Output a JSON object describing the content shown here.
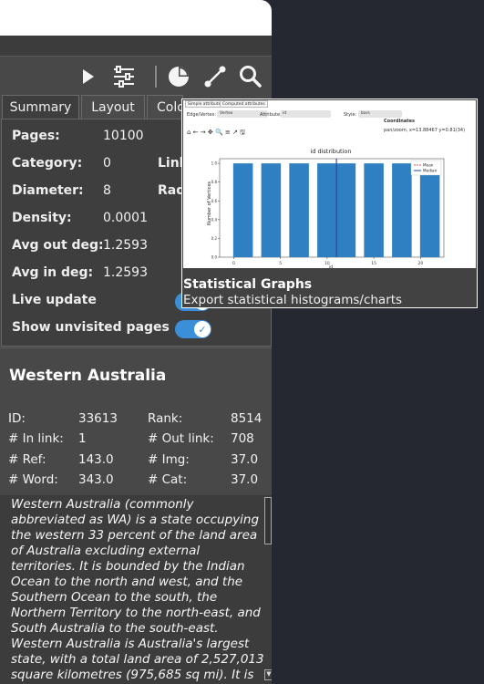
{
  "toolbar": {
    "icons": [
      "play-icon",
      "sliders-icon",
      "pie-chart-icon",
      "graph-edge-icon",
      "search-icon"
    ]
  },
  "tabs": [
    {
      "label": "Summary",
      "active": true
    },
    {
      "label": "Layout",
      "active": false
    },
    {
      "label": "Colo",
      "active": false
    }
  ],
  "summary": {
    "pages_label": "Pages:",
    "pages_value": "10100",
    "category_label": "Category:",
    "category_value": "0",
    "link_label": "Link",
    "diameter_label": "Diameter:",
    "diameter_value": "8",
    "rad_label": "Rad",
    "density_label": "Density:",
    "density_value": "0.0001",
    "avg_out_label": "Avg out deg:",
    "avg_out_value": "1.2593",
    "avg_in_label": "Avg in deg:",
    "avg_in_value": "1.2593",
    "live_update_label": "Live update",
    "live_update_on": true,
    "show_unvisited_label": "Show unvisited pages",
    "show_unvisited_on": true,
    "toggle_check": "✓"
  },
  "page": {
    "title": "Western Australia",
    "id_label": "ID:",
    "id_value": "33613",
    "rank_label": "Rank:",
    "rank_value": "8514",
    "inlink_label": "# In link:",
    "inlink_value": "1",
    "outlink_label": "# Out link:",
    "outlink_value": "708",
    "ref_label": "# Ref:",
    "ref_value": "143.0",
    "img_label": "# Img:",
    "img_value": "37.0",
    "word_label": "# Word:",
    "word_value": "343.0",
    "cat_label": "# Cat:",
    "cat_value": "37.0",
    "description": "Western Australia (commonly abbreviated as WA) is a state occupying the western 33 percent of the land area of Australia excluding external territories. It is bounded by the Indian Ocean to the north and west, and the Southern Ocean to the south, the Northern Territory to the north-east, and South Australia to the south-east. Western Australia is Australia's largest state, with a total land area of 2,527,013 square kilometres (975,685 sq mi). It is the second-largest"
  },
  "tooltip": {
    "title": "Statistical Graphs",
    "subtitle": "Export statistical histograms/charts",
    "preview": {
      "tab1": "Simple attributes",
      "tab2": "Computed attributes",
      "field1_label": "Edge/Vertex:",
      "field1_value": "Vertex",
      "field2_label": "Attribute:",
      "field2_value": "id",
      "field3_label": "Style:",
      "field3_value": "bars",
      "coords_title": "Coordinates",
      "coords_text": "pan/zoom, x=13.88467     y=0.81(34)",
      "chart_title": "id distribution",
      "ylabel": "Number of Vertices",
      "legend_mean": "Mean",
      "legend_median": "Median"
    }
  },
  "chart_data": {
    "type": "bar",
    "title": "id distribution",
    "ylabel": "Number of Vertices",
    "xlabel": "id",
    "x_ticks": [
      "0",
      "5",
      "10",
      "15",
      "20"
    ],
    "y_ticks": [
      "0.0",
      "0.2",
      "0.4",
      "0.6",
      "0.8",
      "1.0"
    ],
    "bar_x": [
      1,
      4,
      7,
      10,
      12,
      15,
      18,
      21
    ],
    "values": [
      1,
      1,
      1,
      1,
      1,
      1,
      1,
      1
    ],
    "xlim": [
      -1.5,
      22.5
    ],
    "ylim": [
      0,
      1.05
    ],
    "mean": 11,
    "median": 11,
    "bar_color": "#2f80c2",
    "mean_color": "#d9534f",
    "median_color": "#1f3fa0"
  }
}
